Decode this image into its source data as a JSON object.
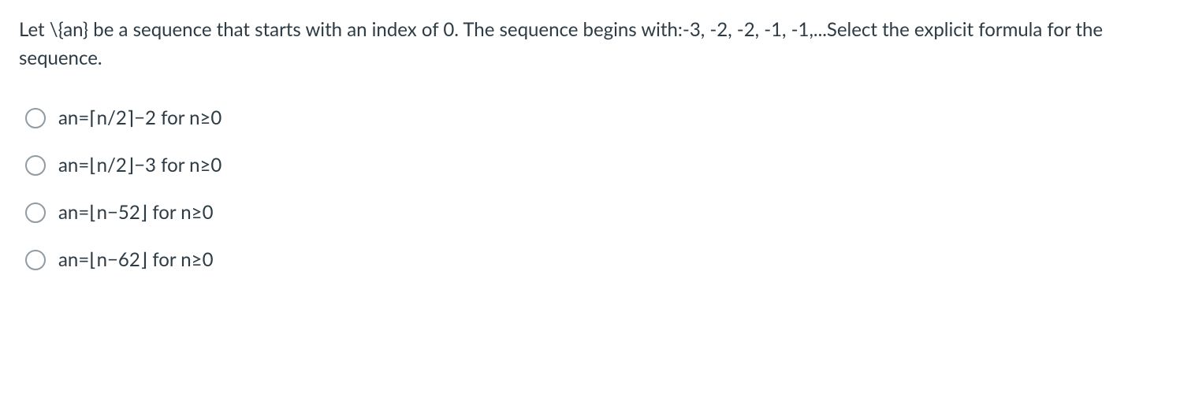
{
  "question": "Let \\{an} be a sequence that starts with an index of 0. The sequence begins with:-3, -2, -2, -1, -1,...Select the explicit formula for the sequence.",
  "options": [
    {
      "label": "an=⌈n/2⌉−2 for n≥0"
    },
    {
      "label": "an=⌊n/2⌋−3 for n≥0"
    },
    {
      "label": "an=⌊n−52⌋ for n≥0"
    },
    {
      "label": "an=⌊n−62⌋ for n≥0"
    }
  ]
}
